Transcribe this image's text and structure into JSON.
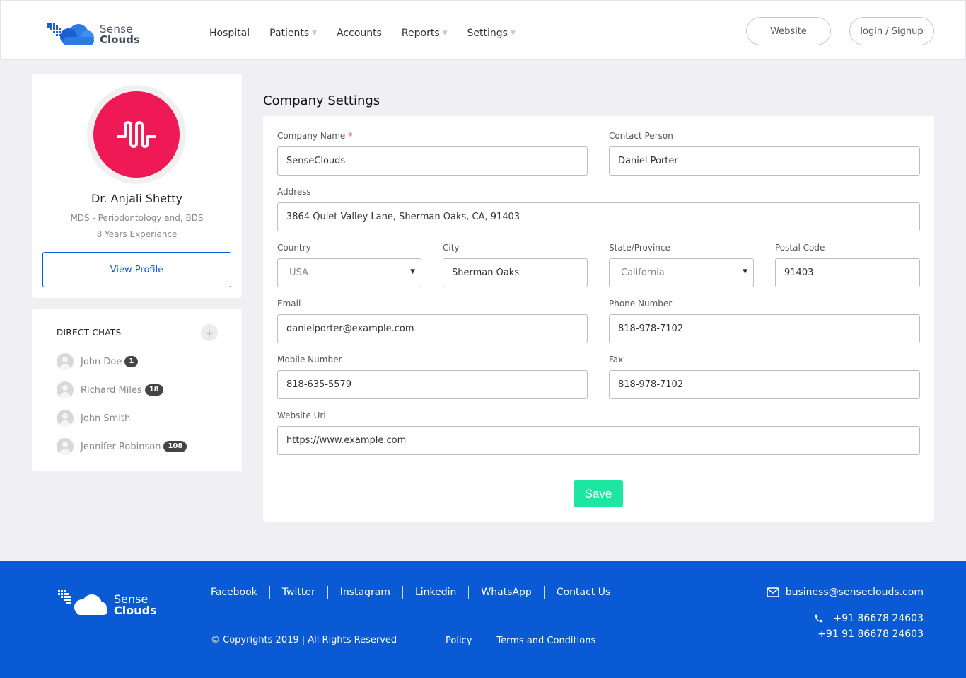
{
  "brand": {
    "line1": "Sense",
    "line2": "Clouds"
  },
  "nav": [
    {
      "label": "Hospital",
      "dropdown": false
    },
    {
      "label": "Patients",
      "dropdown": true
    },
    {
      "label": "Accounts",
      "dropdown": false
    },
    {
      "label": "Reports",
      "dropdown": true
    },
    {
      "label": "Settings",
      "dropdown": true
    }
  ],
  "header_buttons": {
    "website": "Website",
    "login": "login / Signup"
  },
  "profile": {
    "name": "Dr. Anjali Shetty",
    "qualification": "MDS - Periodontology and, BDS",
    "experience": "8 Years Experience",
    "view_profile": "View Profile",
    "avatar_color": "#ef1a55"
  },
  "chats": {
    "title": "DIRECT CHATS",
    "items": [
      {
        "name": "John Doe",
        "badge": "1"
      },
      {
        "name": "Richard Miles",
        "badge": "18"
      },
      {
        "name": "John Smith",
        "badge": ""
      },
      {
        "name": "Jennifer Robinson",
        "badge": "108"
      }
    ]
  },
  "settings": {
    "title": "Company Settings",
    "company_name": {
      "label": "Company Name",
      "required": "*",
      "value": "SenseClouds"
    },
    "contact_person": {
      "label": "Contact Person",
      "value": "Daniel Porter"
    },
    "address": {
      "label": "Address",
      "value": "3864 Quiet Valley Lane, Sherman Oaks, CA, 91403"
    },
    "country": {
      "label": "Country",
      "value": "USA"
    },
    "city": {
      "label": "City",
      "value": "Sherman Oaks"
    },
    "state": {
      "label": "State/Province",
      "value": "California"
    },
    "postal": {
      "label": "Postal Code",
      "value": "91403"
    },
    "email": {
      "label": "Email",
      "value": "danielporter@example.com"
    },
    "phone": {
      "label": "Phone Number",
      "value": "818-978-7102"
    },
    "mobile": {
      "label": "Mobile Number",
      "value": "818-635-5579"
    },
    "fax": {
      "label": "Fax",
      "value": "818-978-7102"
    },
    "website": {
      "label": "Website Url",
      "value": "https://www.example.com"
    },
    "save": "Save",
    "save_color": "#1de6a1"
  },
  "footer": {
    "links": [
      "Facebook",
      "Twitter",
      "Instagram",
      "Linkedin",
      "WhatsApp",
      "Contact Us"
    ],
    "copyright": "© Copyrights 2019 | All Rights Reserved",
    "policy": "Policy",
    "terms": "Terms and Conditions",
    "email": "business@senseclouds.com",
    "phone1": "+91 86678 24603",
    "phone2": "+91 91 86678 24603",
    "bg_color": "#0a5ad6"
  }
}
